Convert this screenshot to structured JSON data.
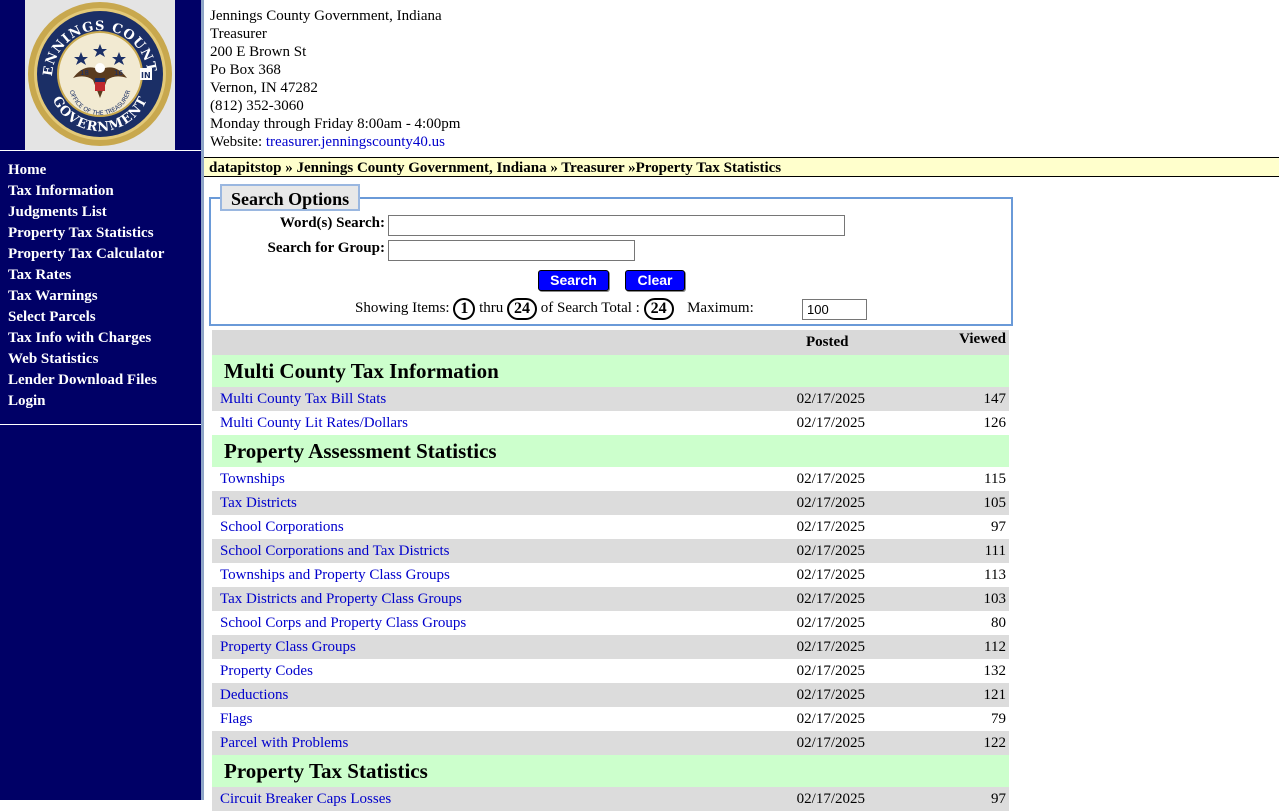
{
  "seal": {
    "top_text": "JENNINGS COUNTY",
    "bottom_text": "GOVERNMENT",
    "inner_text": "OFFICE OF THE TREASURER",
    "year_left": "18",
    "year_right": "16",
    "state_abbr": "IN"
  },
  "sidebar": {
    "items": [
      {
        "label": "Home"
      },
      {
        "label": "Tax Information"
      },
      {
        "label": "Judgments List"
      },
      {
        "label": "Property Tax Statistics"
      },
      {
        "label": "Property Tax Calculator"
      },
      {
        "label": "Tax Rates"
      },
      {
        "label": "Tax Warnings"
      },
      {
        "label": "Select Parcels"
      },
      {
        "label": "Tax Info with Charges"
      },
      {
        "label": "Web Statistics"
      },
      {
        "label": "Lender Download Files"
      },
      {
        "label": "Login"
      }
    ]
  },
  "header": {
    "org": "Jennings County Government, Indiana",
    "dept": "Treasurer",
    "street": "200 E Brown St",
    "pobox": "Po Box 368",
    "city": "Vernon, IN 47282",
    "phone": "(812) 352-3060",
    "hours": "Monday through Friday 8:00am - 4:00pm",
    "website_label": "Website: ",
    "website_url": "treasurer.jenningscounty40.us"
  },
  "breadcrumb": "datapitstop » Jennings County Government, Indiana » Treasurer »Property Tax Statistics",
  "search": {
    "legend": "Search Options",
    "words_label": "Word(s) Search:",
    "words_value": "",
    "group_label": "Search for Group:",
    "group_value": "",
    "search_button": "Search",
    "clear_button": "Clear",
    "showing_label": "Showing Items:",
    "from": "1",
    "thru_label": "thru",
    "to": "24",
    "total_label": "of Search Total :",
    "total": "24",
    "max_label": "Maximum:",
    "max_value": "100"
  },
  "table": {
    "col_posted": "Posted",
    "col_viewed": "Viewed",
    "groups": [
      {
        "title": "Multi County Tax Information",
        "rows": [
          {
            "name": "Multi County Tax Bill Stats",
            "posted": "02/17/2025",
            "viewed": "147"
          },
          {
            "name": "Multi County Lit Rates/Dollars",
            "posted": "02/17/2025",
            "viewed": "126"
          }
        ]
      },
      {
        "title": "Property Assessment Statistics",
        "rows": [
          {
            "name": "Townships",
            "posted": "02/17/2025",
            "viewed": "115"
          },
          {
            "name": "Tax Districts",
            "posted": "02/17/2025",
            "viewed": "105"
          },
          {
            "name": "School Corporations",
            "posted": "02/17/2025",
            "viewed": "97"
          },
          {
            "name": "School Corporations and Tax Districts",
            "posted": "02/17/2025",
            "viewed": "111"
          },
          {
            "name": "Townships and Property Class Groups",
            "posted": "02/17/2025",
            "viewed": "113"
          },
          {
            "name": "Tax Districts and Property Class Groups",
            "posted": "02/17/2025",
            "viewed": "103"
          },
          {
            "name": "School Corps and Property Class Groups",
            "posted": "02/17/2025",
            "viewed": "80"
          },
          {
            "name": "Property Class Groups",
            "posted": "02/17/2025",
            "viewed": "112"
          },
          {
            "name": "Property Codes",
            "posted": "02/17/2025",
            "viewed": "132"
          },
          {
            "name": "Deductions",
            "posted": "02/17/2025",
            "viewed": "121"
          },
          {
            "name": "Flags",
            "posted": "02/17/2025",
            "viewed": "79"
          },
          {
            "name": "Parcel with Problems",
            "posted": "02/17/2025",
            "viewed": "122"
          }
        ]
      },
      {
        "title": "Property Tax Statistics",
        "rows": [
          {
            "name": "Circuit Breaker Caps Losses",
            "posted": "02/17/2025",
            "viewed": "97"
          }
        ]
      }
    ]
  },
  "colors": {
    "sidebar_bg": "#000066",
    "link": "#0000cc",
    "breadcrumb_bg": "#ffffcc",
    "group_bg": "#ccffcc",
    "row_alt_bg": "#dcdcdc",
    "button_bg": "#0000ff"
  }
}
